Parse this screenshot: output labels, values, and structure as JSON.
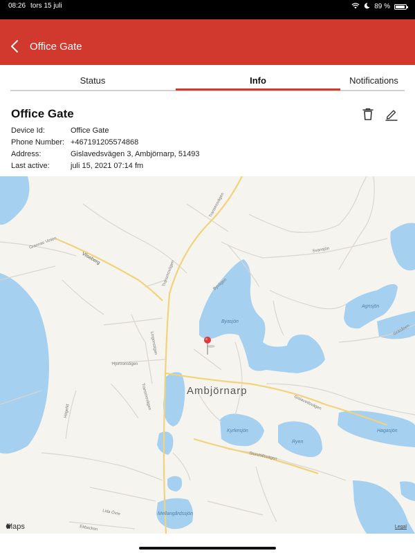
{
  "status_bar": {
    "time": "08:26",
    "date": "tors 15 juli",
    "battery": "89 %"
  },
  "nav": {
    "title": "Office Gate"
  },
  "tabs": [
    {
      "label": "Status",
      "active": false
    },
    {
      "label": "Info",
      "active": true
    },
    {
      "label": "Notifications",
      "active": false
    }
  ],
  "device": {
    "name": "Office Gate",
    "fields": [
      {
        "label": "Device Id:",
        "value": "Office Gate"
      },
      {
        "label": "Phone Number:",
        "value": "+467191205574868"
      },
      {
        "label": "Address:",
        "value": "Gislavedsvägen 3, Ambjörnarp, 51493"
      },
      {
        "label": "Last active:",
        "value": "juli 15, 2021 07:14 fm"
      }
    ]
  },
  "map": {
    "place_label": "Ambjörnarp",
    "lake_labels": [
      "Byasjön",
      "Agnsjön",
      "Kyrkesjön",
      "Ryen",
      "Hagasjön",
      "Mellangårdssjön"
    ],
    "road_labels": [
      "Transmovägen",
      "Vilseberg",
      "Grannas Vinlen",
      "Svansjön",
      "Byvägen",
      "Lingonstigen",
      "Hjortronstigen",
      "Transmovägen",
      "Högelid",
      "Gislavedsvägen",
      "Sturehillsvägen",
      "Gräsåsen",
      "Lida Övre",
      "Ekbacken"
    ],
    "brand": "Maps",
    "legal": "Legal",
    "colors": {
      "water": "#a5d0f0",
      "land": "#f6f4ef",
      "road": "#f6dd9a",
      "minor_road": "#d9d6cf"
    }
  },
  "colors": {
    "accent": "#d1382e"
  }
}
